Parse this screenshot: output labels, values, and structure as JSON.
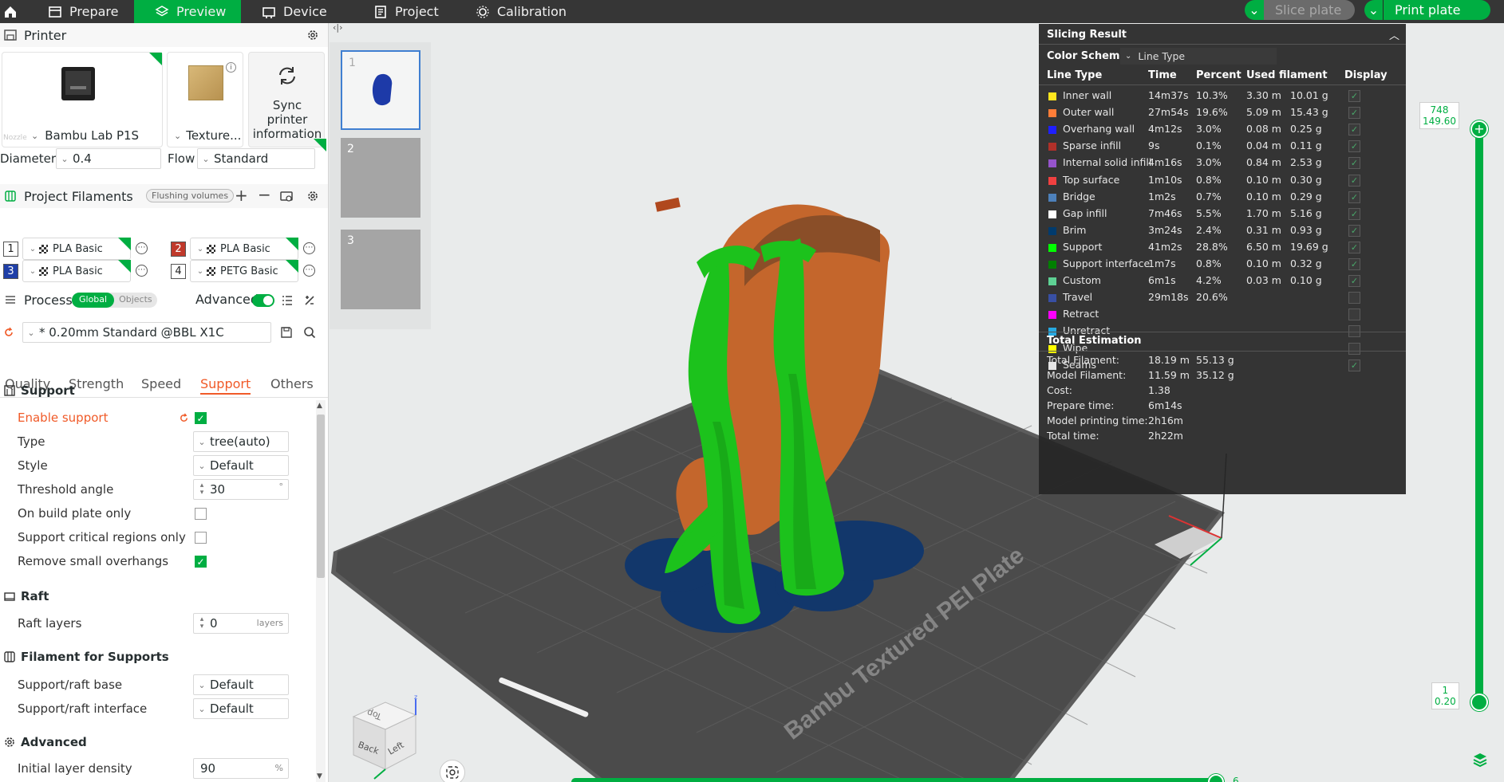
{
  "topbar": {
    "tabs": [
      {
        "label": "Prepare"
      },
      {
        "label": "Preview"
      },
      {
        "label": "Device"
      },
      {
        "label": "Project"
      },
      {
        "label": "Calibration"
      }
    ],
    "slice_label": "Slice plate",
    "print_label": "Print plate"
  },
  "printer": {
    "section_title": "Printer",
    "name": "Bambu Lab P1S",
    "plate": "Texture...",
    "sync_label": "Sync printer information",
    "nozzle_label": "Nozzle",
    "diameter_label": "Diameter",
    "diameter_value": "0.4",
    "flow_label": "Flow",
    "flow_value": "Standard"
  },
  "filaments": {
    "section_title": "Project Filaments",
    "flushing_label": "Flushing volumes",
    "items": [
      {
        "index": "1",
        "name": "PLA Basic",
        "color": "#ffffff"
      },
      {
        "index": "2",
        "name": "PLA Basic",
        "color": "#c0392b"
      },
      {
        "index": "3",
        "name": "PLA Basic",
        "color": "#1f3fa8"
      },
      {
        "index": "4",
        "name": "PETG Basic",
        "color": "#ffffff"
      }
    ]
  },
  "process": {
    "section_title": "Process",
    "global_label": "Global",
    "objects_label": "Objects",
    "advanced_label": "Advanced",
    "preset": "* 0.20mm Standard @BBL X1C",
    "tabs": [
      "Quality",
      "Strength",
      "Speed",
      "Support",
      "Others"
    ],
    "active_tab": "Support"
  },
  "support": {
    "title": "Support",
    "enable_label": "Enable support",
    "type_label": "Type",
    "type_value": "tree(auto)",
    "style_label": "Style",
    "style_value": "Default",
    "threshold_label": "Threshold angle",
    "threshold_value": "30",
    "threshold_unit": "°",
    "build_plate_only_label": "On build plate only",
    "critical_label": "Support critical regions only",
    "remove_small_label": "Remove small overhangs"
  },
  "raft": {
    "title": "Raft",
    "layers_label": "Raft layers",
    "layers_value": "0",
    "layers_unit": "layers"
  },
  "filament_supports": {
    "title": "Filament for Supports",
    "base_label": "Support/raft base",
    "base_value": "Default",
    "interface_label": "Support/raft interface",
    "interface_value": "Default"
  },
  "advanced": {
    "title": "Advanced",
    "density_label": "Initial layer density",
    "density_value": "90",
    "density_unit": "%"
  },
  "thumbnails": [
    "1",
    "2",
    "3"
  ],
  "slicing_result": {
    "title": "Slicing Result",
    "color_scheme_label": "Color Scheme",
    "color_scheme_value": "Line Type",
    "headers": {
      "type": "Line Type",
      "time": "Time",
      "percent": "Percent",
      "filament": "Used filament",
      "display": "Display"
    },
    "rows": [
      {
        "name": "Inner wall",
        "color": "#ffe61e",
        "time": "14m37s",
        "percent": "10.3%",
        "m": "3.30 m",
        "g": "10.01 g",
        "display": true
      },
      {
        "name": "Outer wall",
        "color": "#ff7d38",
        "time": "27m54s",
        "percent": "19.6%",
        "m": "5.09 m",
        "g": "15.43 g",
        "display": true
      },
      {
        "name": "Overhang wall",
        "color": "#1f1fff",
        "time": "4m12s",
        "percent": "3.0%",
        "m": "0.08 m",
        "g": "0.25 g",
        "display": true
      },
      {
        "name": "Sparse infill",
        "color": "#b03029",
        "time": "9s",
        "percent": "0.1%",
        "m": "0.04 m",
        "g": "0.11 g",
        "display": true
      },
      {
        "name": "Internal solid infill",
        "color": "#9654cc",
        "time": "4m16s",
        "percent": "3.0%",
        "m": "0.84 m",
        "g": "2.53 g",
        "display": true
      },
      {
        "name": "Top surface",
        "color": "#f04040",
        "time": "1m10s",
        "percent": "0.8%",
        "m": "0.10 m",
        "g": "0.30 g",
        "display": true
      },
      {
        "name": "Bridge",
        "color": "#4d80ba",
        "time": "1m2s",
        "percent": "0.7%",
        "m": "0.10 m",
        "g": "0.29 g",
        "display": true
      },
      {
        "name": "Gap infill",
        "color": "#ffffff",
        "time": "7m46s",
        "percent": "5.5%",
        "m": "1.70 m",
        "g": "5.16 g",
        "display": true
      },
      {
        "name": "Brim",
        "color": "#003b6e",
        "time": "3m24s",
        "percent": "2.4%",
        "m": "0.31 m",
        "g": "0.93 g",
        "display": true
      },
      {
        "name": "Support",
        "color": "#00ff00",
        "time": "41m2s",
        "percent": "28.8%",
        "m": "6.50 m",
        "g": "19.69 g",
        "display": true
      },
      {
        "name": "Support interface",
        "color": "#008000",
        "time": "1m7s",
        "percent": "0.8%",
        "m": "0.10 m",
        "g": "0.32 g",
        "display": true
      },
      {
        "name": "Custom",
        "color": "#5ed194",
        "time": "6m1s",
        "percent": "4.2%",
        "m": "0.03 m",
        "g": "0.10 g",
        "display": true
      },
      {
        "name": "Travel",
        "color": "#384fa3",
        "time": "29m18s",
        "percent": "20.6%",
        "m": "",
        "g": "",
        "display": false
      },
      {
        "name": "Retract",
        "color": "#ff00ff",
        "time": "",
        "percent": "",
        "m": "",
        "g": "",
        "display": false
      },
      {
        "name": "Unretract",
        "color": "#27a9e1",
        "time": "",
        "percent": "",
        "m": "",
        "g": "",
        "display": false
      },
      {
        "name": "Wipe",
        "color": "#ffff00",
        "time": "",
        "percent": "",
        "m": "",
        "g": "",
        "display": false
      },
      {
        "name": "Seams",
        "color": "#e6e6e6",
        "time": "",
        "percent": "",
        "m": "",
        "g": "",
        "display": true
      }
    ],
    "estimation_title": "Total Estimation",
    "estimation": [
      {
        "label": "Total Filament:",
        "v1": "18.19 m",
        "v2": "55.13 g"
      },
      {
        "label": "Model Filament:",
        "v1": "11.59 m",
        "v2": "35.12 g"
      },
      {
        "label": "Cost:",
        "v1": "1.38",
        "v2": ""
      },
      {
        "label": "Prepare time:",
        "v1": "6m14s",
        "v2": ""
      },
      {
        "label": "Model printing time:",
        "v1": "2h16m",
        "v2": ""
      },
      {
        "label": "Total time:",
        "v1": "2h22m",
        "v2": ""
      }
    ]
  },
  "layer_slider": {
    "top_layer": "748",
    "top_height": "149.60",
    "bottom_layer": "1",
    "bottom_height": "0.20"
  },
  "move_slider": {
    "value": "6"
  },
  "plate_label": "Bambu Textured PEI Plate",
  "view_cube": {
    "top": "Top",
    "back": "Back",
    "left": "Left"
  }
}
